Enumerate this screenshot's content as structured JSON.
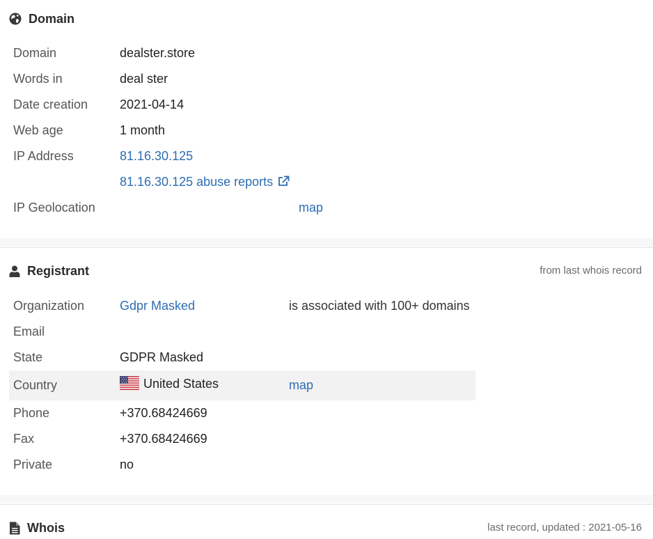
{
  "domain_section": {
    "title": "Domain",
    "rows": {
      "domain": {
        "label": "Domain",
        "value": "dealster.store"
      },
      "words": {
        "label": "Words in",
        "value": "deal ster"
      },
      "date_creation": {
        "label": "Date creation",
        "value": "2021-04-14"
      },
      "web_age": {
        "label": "Web age",
        "value": "1 month"
      },
      "ip_address": {
        "label": "IP Address",
        "value": "81.16.30.125"
      },
      "abuse": {
        "value": "81.16.30.125 abuse reports"
      },
      "geolocation": {
        "label": "IP Geolocation",
        "map_label": "map"
      }
    }
  },
  "registrant_section": {
    "title": "Registrant",
    "note": "from last whois record",
    "rows": {
      "organization": {
        "label": "Organization",
        "value": "Gdpr Masked",
        "extra": "is associated with 100+ domains"
      },
      "email": {
        "label": "Email"
      },
      "state": {
        "label": "State",
        "value": "GDPR Masked"
      },
      "country": {
        "label": "Country",
        "value": "United States",
        "map_label": "map"
      },
      "phone": {
        "label": "Phone",
        "value": "+370.68424669"
      },
      "fax": {
        "label": "Fax",
        "value": "+370.68424669"
      },
      "private": {
        "label": "Private",
        "value": "no"
      }
    }
  },
  "whois_section": {
    "title": "Whois",
    "note": "last record, updated : 2021-05-16"
  },
  "icons": {
    "domain": "globe-icon",
    "registrant": "user-icon",
    "whois": "document-icon",
    "abuse": "external-link-icon",
    "country": "us-flag-icon"
  },
  "colors": {
    "link": "#2e6db4",
    "row_highlight": "#f2f2f2"
  }
}
